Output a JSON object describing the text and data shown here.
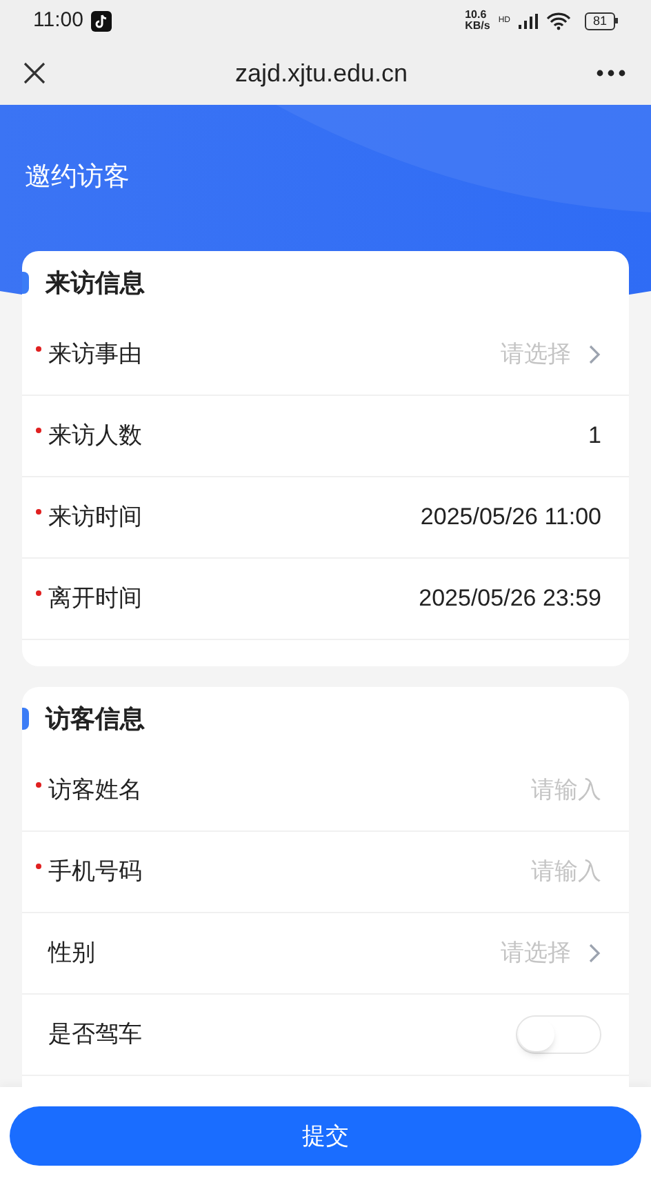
{
  "status_bar": {
    "time": "11:00",
    "speed": "10.6",
    "speed_unit": "KB/s",
    "network": "HD",
    "battery": "81"
  },
  "browser_bar": {
    "url": "zajd.xjtu.edu.cn"
  },
  "page_title": "邀约访客",
  "sections": [
    {
      "title": "来访信息",
      "rows": [
        {
          "kind": "select",
          "label": "来访事由",
          "required": true,
          "placeholder": "请选择"
        },
        {
          "kind": "value",
          "label": "来访人数",
          "required": true,
          "value": "1"
        },
        {
          "kind": "value",
          "label": "来访时间",
          "required": true,
          "value": "2025/05/26 11:00"
        },
        {
          "kind": "value",
          "label": "离开时间",
          "required": true,
          "value": "2025/05/26 23:59"
        }
      ]
    },
    {
      "title": "访客信息",
      "rows": [
        {
          "kind": "input",
          "label": "访客姓名",
          "required": true,
          "placeholder": "请输入"
        },
        {
          "kind": "input",
          "label": "手机号码",
          "required": true,
          "placeholder": "请输入"
        },
        {
          "kind": "select",
          "label": "性别",
          "required": false,
          "placeholder": "请选择"
        },
        {
          "kind": "switch",
          "label": "是否驾车",
          "required": false,
          "on": false
        }
      ]
    }
  ],
  "submit": "提交"
}
